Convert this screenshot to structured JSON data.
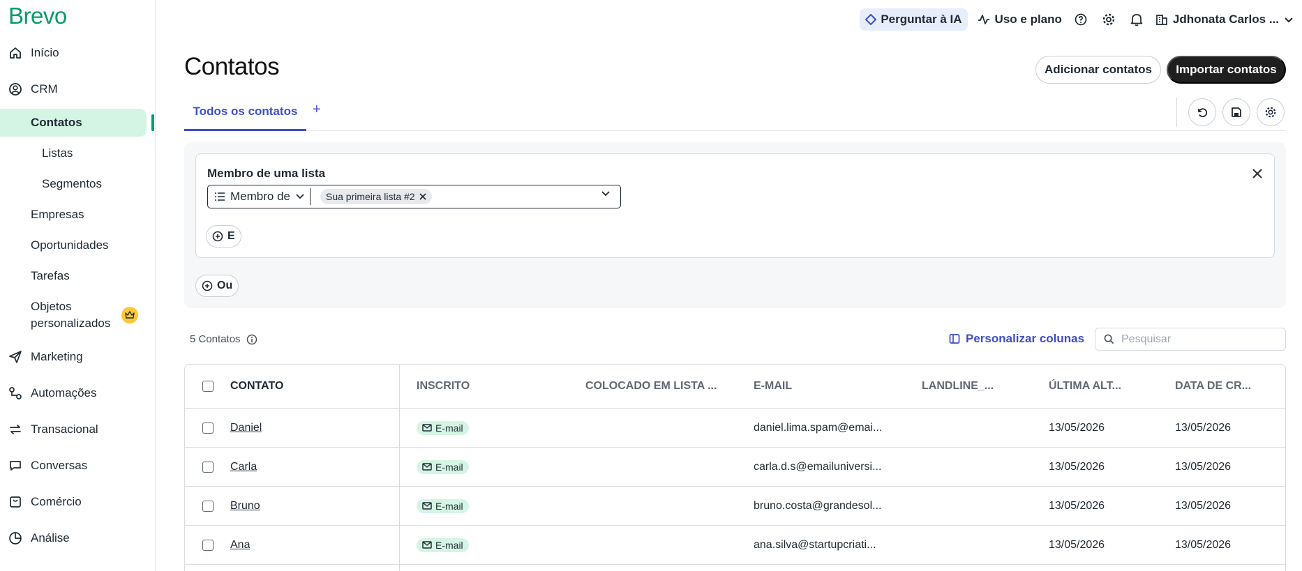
{
  "brand": {
    "logo": "Brevo",
    "accent": "#0b996e",
    "link_color": "#3d4ec9"
  },
  "sidebar": {
    "items": [
      {
        "label": "Início",
        "icon": "home-icon"
      },
      {
        "label": "CRM",
        "icon": "user-circle-icon"
      },
      {
        "label": "Contatos",
        "active": true
      },
      {
        "label": "Listas",
        "sub": true
      },
      {
        "label": "Segmentos",
        "sub": true
      },
      {
        "label": "Empresas"
      },
      {
        "label": "Oportunidades"
      },
      {
        "label": "Tarefas"
      },
      {
        "label": "Objetos",
        "label2": "personalizados",
        "badge": "crown-icon"
      },
      {
        "label": "Marketing",
        "icon": "send-icon"
      },
      {
        "label": "Automações",
        "icon": "automation-icon"
      },
      {
        "label": "Transacional",
        "icon": "transfer-icon"
      },
      {
        "label": "Conversas",
        "icon": "chat-icon"
      },
      {
        "label": "Comércio",
        "icon": "shop-icon"
      },
      {
        "label": "Análise",
        "icon": "pie-chart-icon"
      }
    ]
  },
  "topbar": {
    "ai_label": "Perguntar à IA",
    "usage_label": "Uso e plano",
    "account_name": "Jdhonata Carlos ..."
  },
  "page": {
    "title": "Contatos",
    "add_button": "Adicionar contatos",
    "import_button": "Importar contatos",
    "tab_all": "Todos os contatos",
    "tab_add": "+"
  },
  "filter": {
    "title": "Membro de uma lista",
    "operator": "Membro de",
    "chip": "Sua primeira lista #2",
    "and_label": "E",
    "or_label": "Ou"
  },
  "table_meta": {
    "count": "5 Contatos",
    "customize": "Personalizar colunas",
    "search_placeholder": "Pesquisar"
  },
  "table": {
    "headers": [
      "CONTATO",
      "INSCRITO",
      "COLOCADO EM LISTA ...",
      "E-MAIL",
      "LANDLINE_...",
      "ÚLTIMA ALT...",
      "DATA DE CR..."
    ],
    "rows": [
      {
        "name": "Daniel",
        "subscribed": "E-mail",
        "list": "",
        "email": "daniel.lima.spam@emai...",
        "landline": "",
        "updated": "13/05/2026",
        "created": "13/05/2026"
      },
      {
        "name": "Carla",
        "subscribed": "E-mail",
        "list": "",
        "email": "carla.d.s@emailuniversi...",
        "landline": "",
        "updated": "13/05/2026",
        "created": "13/05/2026"
      },
      {
        "name": "Bruno",
        "subscribed": "E-mail",
        "list": "",
        "email": "bruno.costa@grandesol...",
        "landline": "",
        "updated": "13/05/2026",
        "created": "13/05/2026"
      },
      {
        "name": "Ana",
        "subscribed": "E-mail",
        "list": "",
        "email": "ana.silva@startupcriati...",
        "landline": "",
        "updated": "13/05/2026",
        "created": "13/05/2026"
      }
    ]
  }
}
